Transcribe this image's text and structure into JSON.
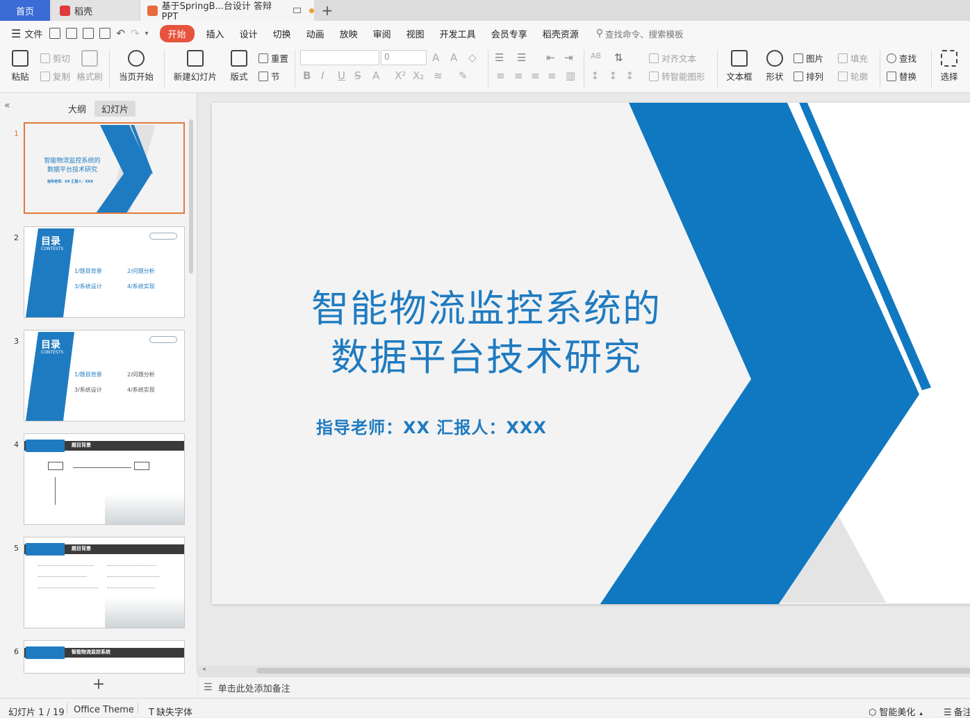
{
  "titlebar": {
    "home_tab": "首页",
    "daoke_tab": "稻壳",
    "doc_tab": "基于SpringB...台设计 答辩PPT",
    "add_tab": "+"
  },
  "menu": {
    "file": "文件",
    "items": [
      "开始",
      "插入",
      "设计",
      "切换",
      "动画",
      "放映",
      "审阅",
      "视图",
      "开发工具",
      "会员专享",
      "稻壳资源"
    ],
    "search_placeholder": "查找命令、搜索模板"
  },
  "ribbon": {
    "paste": "粘贴",
    "cut": "剪切",
    "copy": "复制",
    "format_painter": "格式刷",
    "from_current": "当页开始",
    "new_slide": "新建幻灯片",
    "layout": "版式",
    "reset": "重置",
    "section": "节",
    "font_size": "0",
    "align_text": "对齐文本",
    "smart_graphic": "转智能图形",
    "textbox": "文本框",
    "shape": "形状",
    "arrange": "排列",
    "picture": "图片",
    "fill": "填充",
    "outline": "轮廓",
    "find": "查找",
    "replace": "替换",
    "select": "选择"
  },
  "left_panel": {
    "outline_tab": "大纲",
    "slides_tab": "幻灯片",
    "numbers": [
      "1",
      "2",
      "3",
      "4",
      "5",
      "6"
    ],
    "thumb1": {
      "title_line1": "智能物流监控系统的",
      "title_line2": "数据平台技术研究",
      "sub": "指导老师：XX  汇报人：XXX"
    },
    "toc": {
      "title": "目录",
      "en": "CONTESTS",
      "items": [
        "题目背景",
        "问题分析",
        "系统设计",
        "系统实现"
      ],
      "nums": [
        "1/",
        "2/",
        "3/",
        "4/"
      ]
    },
    "thumb4_header": "题目背景",
    "thumb5_header": "题目背景",
    "thumb6_header": "智能物流监控系统",
    "add": "+"
  },
  "slide": {
    "title_line1": "智能物流监控系统的",
    "title_line2": "数据平台技术研究",
    "subtitle": "指导老师：XX  汇报人：XXX"
  },
  "notes": {
    "placeholder": "单击此处添加备注"
  },
  "status": {
    "slide_counter": "幻灯片 1 / 19",
    "theme": "Office Theme",
    "missing_font": "缺失字体",
    "beautify": "智能美化",
    "notes": "备注"
  },
  "colors": {
    "accent": "#1f7bc1",
    "active_menu": "#e8533d",
    "home_tab": "#3b6bd6"
  }
}
